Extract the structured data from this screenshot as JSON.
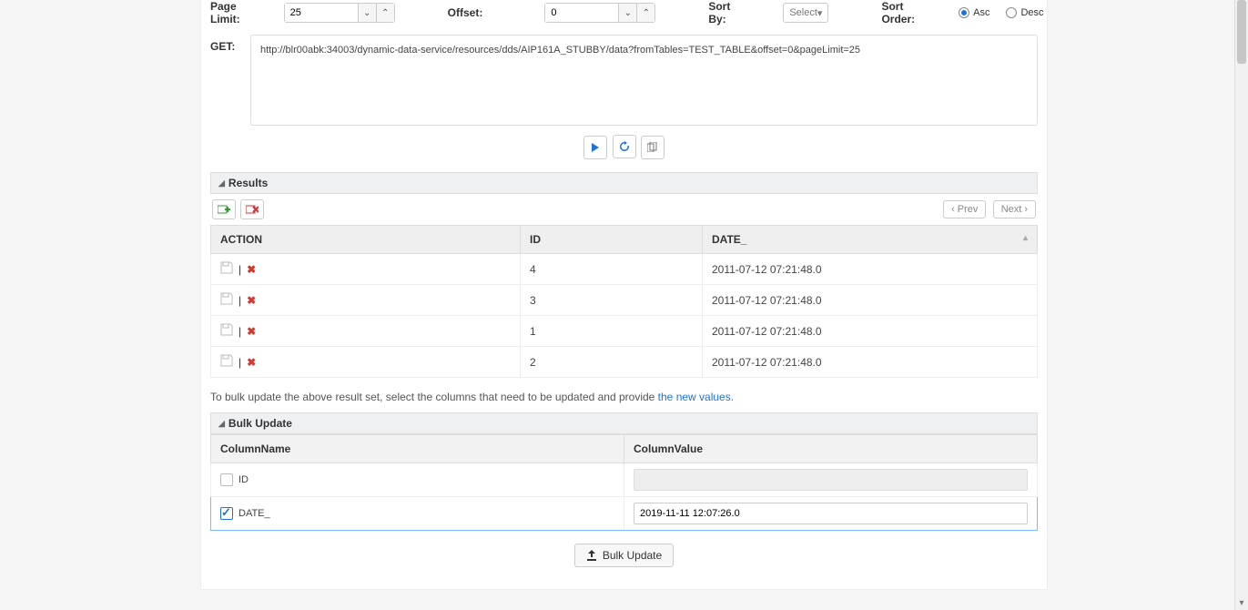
{
  "filters": {
    "pageLimit": {
      "label": "Page Limit:",
      "value": "25"
    },
    "offset": {
      "label": "Offset:",
      "value": "0"
    },
    "sortBy": {
      "label": "Sort By:",
      "value": "Select"
    },
    "sortOrder": {
      "label": "Sort Order:",
      "asc": "Asc",
      "desc": "Desc",
      "selected": "asc"
    }
  },
  "request": {
    "method": "GET:",
    "url": "http://blr00abk:34003/dynamic-data-service/resources/dds/AIP161A_STUBBY/data?fromTables=TEST_TABLE&offset=0&pageLimit=25"
  },
  "action_icons": {
    "run": "play-icon",
    "refresh": "refresh-icon",
    "copy": "copy-icon"
  },
  "results": {
    "title": "Results",
    "toolbar": {
      "add": "add-row-icon",
      "delete": "delete-row-icon"
    },
    "pager": {
      "prev": "Prev",
      "next": "Next"
    },
    "columns": {
      "action": "ACTION",
      "id": "ID",
      "date": "DATE_"
    },
    "rows": [
      {
        "id": "4",
        "date": "2011-07-12 07:21:48.0"
      },
      {
        "id": "3",
        "date": "2011-07-12 07:21:48.0"
      },
      {
        "id": "1",
        "date": "2011-07-12 07:21:48.0"
      },
      {
        "id": "2",
        "date": "2011-07-12 07:21:48.0"
      }
    ]
  },
  "hint_text_1": "To bulk update the above result set, select the columns that need to be updated and provide ",
  "hint_link": "the new values.",
  "bulk": {
    "title": "Bulk Update",
    "col_name": "ColumnName",
    "col_value": "ColumnValue",
    "rows": [
      {
        "name": "ID",
        "checked": false,
        "value": ""
      },
      {
        "name": "DATE_",
        "checked": true,
        "value": "2019-11-11 12:07:26.0"
      }
    ],
    "button": "Bulk Update"
  }
}
